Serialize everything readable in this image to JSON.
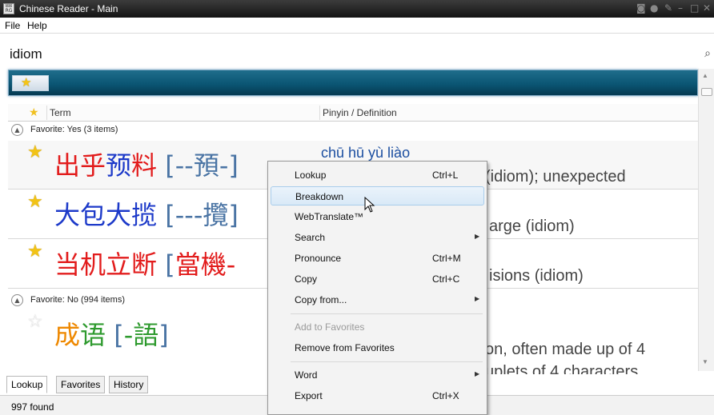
{
  "window": {
    "title": "Chinese Reader - Main",
    "icon_text": "BB RG"
  },
  "menu": {
    "file": "File",
    "help": "Help"
  },
  "search": {
    "value": "idiom"
  },
  "columns": {
    "term": "Term",
    "pinyin_definition": "Pinyin / Definition"
  },
  "groups": [
    {
      "label": "Favorite: Yes (3 items)"
    },
    {
      "label": "Favorite: No (994 items)"
    }
  ],
  "rows": [
    {
      "starred": true,
      "simplified": "出乎预料",
      "open": "[",
      "trad": "--預-",
      "close": "]",
      "pinyin": "chū hū yù liào",
      "definition": "(idiom); unexpected",
      "chars": [
        [
          "出",
          "red"
        ],
        [
          "乎",
          "red"
        ],
        [
          "预",
          "blue"
        ],
        [
          "料",
          "red"
        ]
      ]
    },
    {
      "starred": true,
      "simplified": "大包大揽",
      "open": "[",
      "trad": "---攬",
      "close": "]",
      "pinyin": "",
      "definition": "arge (idiom)",
      "chars": [
        [
          "大",
          "blue"
        ],
        [
          "包",
          "blue"
        ],
        [
          "大",
          "blue"
        ],
        [
          "揽",
          "blue"
        ]
      ]
    },
    {
      "starred": true,
      "simplified": "当机立断",
      "open": "[",
      "trad": "當機-",
      "close": "",
      "pinyin": "",
      "definition": "isions (idiom)",
      "chars": [
        [
          "当",
          "red"
        ],
        [
          "机",
          "red"
        ],
        [
          "立",
          "red"
        ],
        [
          "断",
          "red"
        ]
      ]
    },
    {
      "starred": false,
      "simplified": "成语",
      "open": "[",
      "trad": "-語",
      "close": "]",
      "pinyin": "",
      "definition": "on, often made up of 4",
      "definition2": "uplets of 4 characters",
      "chars": [
        [
          "成",
          "orange"
        ],
        [
          "语",
          "green"
        ]
      ]
    }
  ],
  "tabs": [
    "Lookup",
    "Favorites",
    "History"
  ],
  "status": {
    "found": "997 found"
  },
  "context_menu": {
    "items": [
      {
        "label": "Lookup",
        "shortcut": "Ctrl+L",
        "submenu": false,
        "disabled": false,
        "highlighted": false
      },
      {
        "label": "Breakdown",
        "shortcut": "",
        "submenu": false,
        "disabled": false,
        "highlighted": true
      },
      {
        "label": "WebTranslate™",
        "shortcut": "",
        "submenu": false,
        "disabled": false,
        "highlighted": false
      },
      {
        "label": "Search",
        "shortcut": "",
        "submenu": true,
        "disabled": false,
        "highlighted": false
      },
      {
        "label": "Pronounce",
        "shortcut": "Ctrl+M",
        "submenu": false,
        "disabled": false,
        "highlighted": false
      },
      {
        "label": "Copy",
        "shortcut": "Ctrl+C",
        "submenu": false,
        "disabled": false,
        "highlighted": false
      },
      {
        "label": "Copy from...",
        "shortcut": "",
        "submenu": true,
        "disabled": false,
        "highlighted": false
      },
      {
        "label": "Add to Favorites",
        "shortcut": "",
        "submenu": false,
        "disabled": true,
        "highlighted": false
      },
      {
        "label": "Remove from Favorites",
        "shortcut": "",
        "submenu": false,
        "disabled": false,
        "highlighted": false
      },
      {
        "label": "Word",
        "shortcut": "",
        "submenu": true,
        "disabled": false,
        "highlighted": false
      },
      {
        "label": "Export",
        "shortcut": "Ctrl+X",
        "submenu": false,
        "disabled": false,
        "highlighted": false
      }
    ]
  },
  "colors": {
    "accent_banner": "#0b5674",
    "star": "#f2c316",
    "highlight": "#d9e9f7"
  }
}
